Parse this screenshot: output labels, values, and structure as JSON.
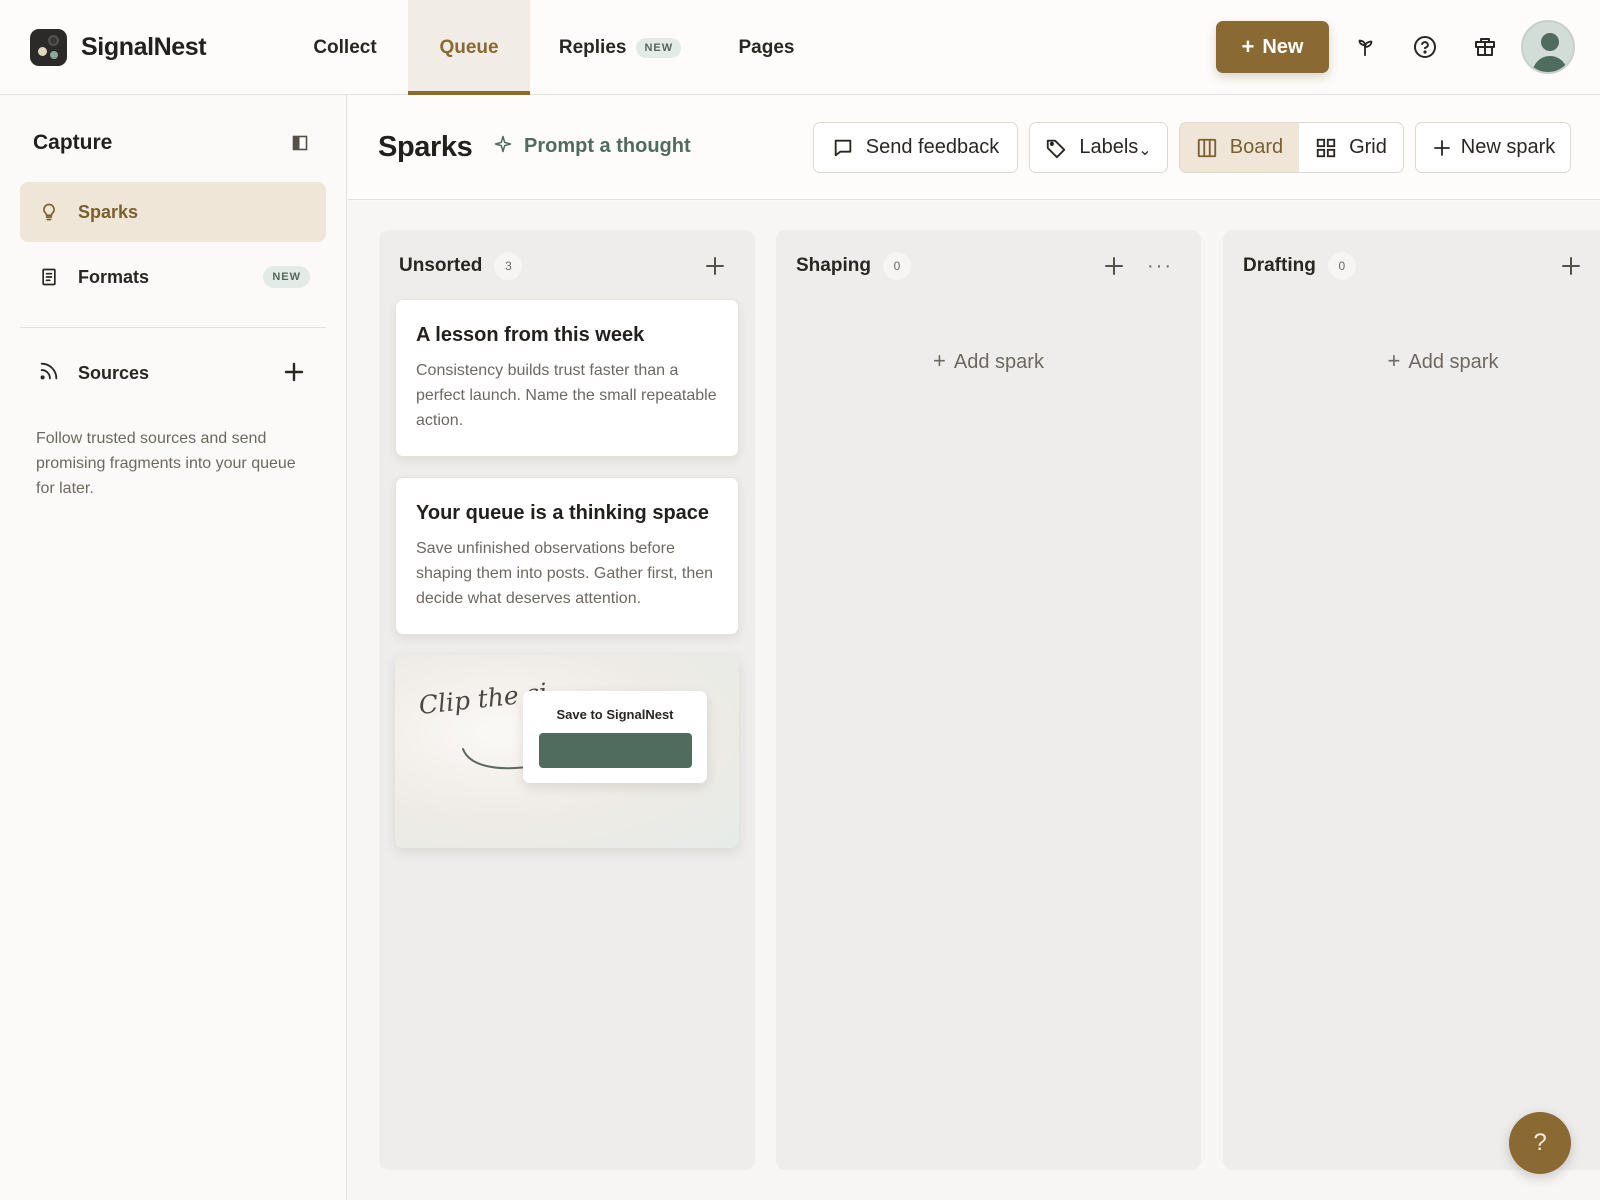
{
  "brand": {
    "name": "SignalNest"
  },
  "nav": {
    "tabs": [
      {
        "label": "Collect"
      },
      {
        "label": "Queue",
        "active": true
      },
      {
        "label": "Replies",
        "badge": "NEW"
      },
      {
        "label": "Pages"
      }
    ]
  },
  "topbar": {
    "new_button": {
      "icon": "+",
      "label": "New"
    },
    "icons": [
      "sprout-icon",
      "help-circle-icon",
      "gift-icon"
    ],
    "avatar_icon": "user-avatar"
  },
  "sidebar": {
    "title": "Capture",
    "items": [
      {
        "label": "Sparks",
        "icon": "lightbulb-icon",
        "active": true
      },
      {
        "label": "Formats",
        "icon": "document-icon",
        "badge": "NEW"
      }
    ],
    "sources": {
      "label": "Sources",
      "icon": "rss-icon",
      "add": "+"
    },
    "description": "Follow trusted sources and send promising fragments into your queue for later."
  },
  "header": {
    "title": "Sparks",
    "prompt_link": "Prompt a thought",
    "send_feedback": "Send feedback",
    "labels": "Labels",
    "labels_caret": "⌄",
    "view_options": [
      {
        "label": "Board",
        "active": true
      },
      {
        "label": "Grid"
      }
    ],
    "new_spark": "New spark"
  },
  "board": {
    "columns": [
      {
        "title": "Unsorted",
        "count": "3",
        "cards": [
          {
            "title": "A lesson from this week",
            "body": "Consistency builds trust faster than a perfect launch. Name the small repeatable action."
          },
          {
            "title": "Your queue is a thinking space",
            "body": "Save unfinished observations before shaping them into posts. Gather first, then decide what deserves attention."
          }
        ],
        "image_card": {
          "clip_text": "Clip the si",
          "popup_title": "Save to SignalNest"
        }
      },
      {
        "title": "Shaping",
        "count": "0",
        "add_label": "Add spark",
        "more": "···"
      },
      {
        "title": "Drafting",
        "count": "0",
        "add_label": "Add spark"
      }
    ],
    "add_symbol": "+"
  },
  "help_fab": {
    "label": "?"
  },
  "colors": {
    "accent": "#8a6a32",
    "accent_soft": "#efe6d7",
    "green": "#4f6c5f",
    "badge_bg": "#e3ebe6"
  }
}
